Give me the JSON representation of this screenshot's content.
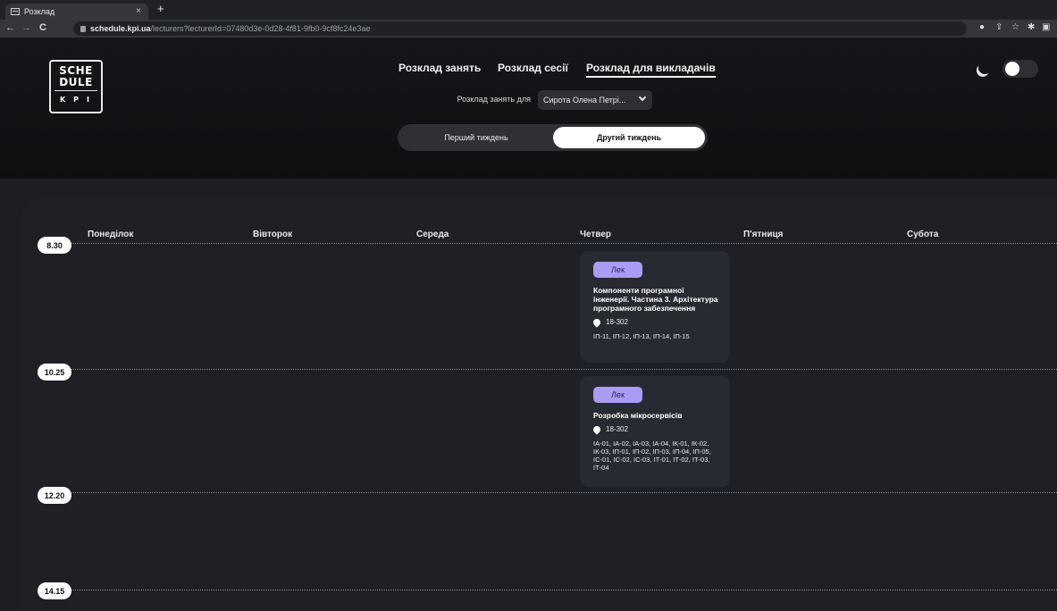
{
  "browser": {
    "tab_title": "Розклад",
    "tab_close": "×",
    "new_tab": "+",
    "url_host": "schedule.kpi.ua",
    "url_path": "/lecturers?lecturerId=07480d3e-0d28-4f81-9fb0-9cf8fc24e3ae",
    "nav_back": "←",
    "nav_forward": "→",
    "nav_reload": "C"
  },
  "logo": {
    "line1": "SCHE",
    "line2": "DULE",
    "line3": "KPI"
  },
  "nav": {
    "items": [
      {
        "label": "Розклад занять",
        "active": false
      },
      {
        "label": "Розклад сесії",
        "active": false
      },
      {
        "label": "Розклад для викладачів",
        "active": true
      }
    ]
  },
  "theme": {
    "dark_mode": true
  },
  "filter": {
    "label": "Розклад занять для",
    "selected": "Сирота Олена Петрі..."
  },
  "weeks": {
    "options": [
      "Перший тиждень",
      "Другий тиждень"
    ],
    "selected": "Другий тиждень"
  },
  "schedule": {
    "days": [
      "Понеділок",
      "Вівторок",
      "Середа",
      "Четвер",
      "П'ятниця",
      "Субота"
    ],
    "times": [
      "8.30",
      "10.25",
      "12.20",
      "14.15"
    ],
    "lessons": [
      {
        "day": "Четвер",
        "time": "8.30",
        "type": "Лек",
        "title": "Компоненти програмної інженерії. Частина 3. Архітектура програмного забезпечення",
        "room": "18-302",
        "groups": "ІП-11, ІП-12, ІП-13, ІП-14, ІП-15"
      },
      {
        "day": "Четвер",
        "time": "10.25",
        "type": "Лек",
        "title": "Розробка мікросервісів",
        "room": "18-302",
        "groups": "ІА-01, ІА-02, ІА-03, ІА-04, ІК-01, ІК-02, ІК-03, ІП-01, ІП-02, ІП-03, ІП-04, ІП-05, ІС-01, ІС-02, ІС-03, ІТ-01, ІТ-02, ІТ-03, ІТ-04"
      }
    ]
  },
  "colors": {
    "accent_badge": "#a99cf4",
    "background": "#1c1e24",
    "card": "#282a31"
  }
}
